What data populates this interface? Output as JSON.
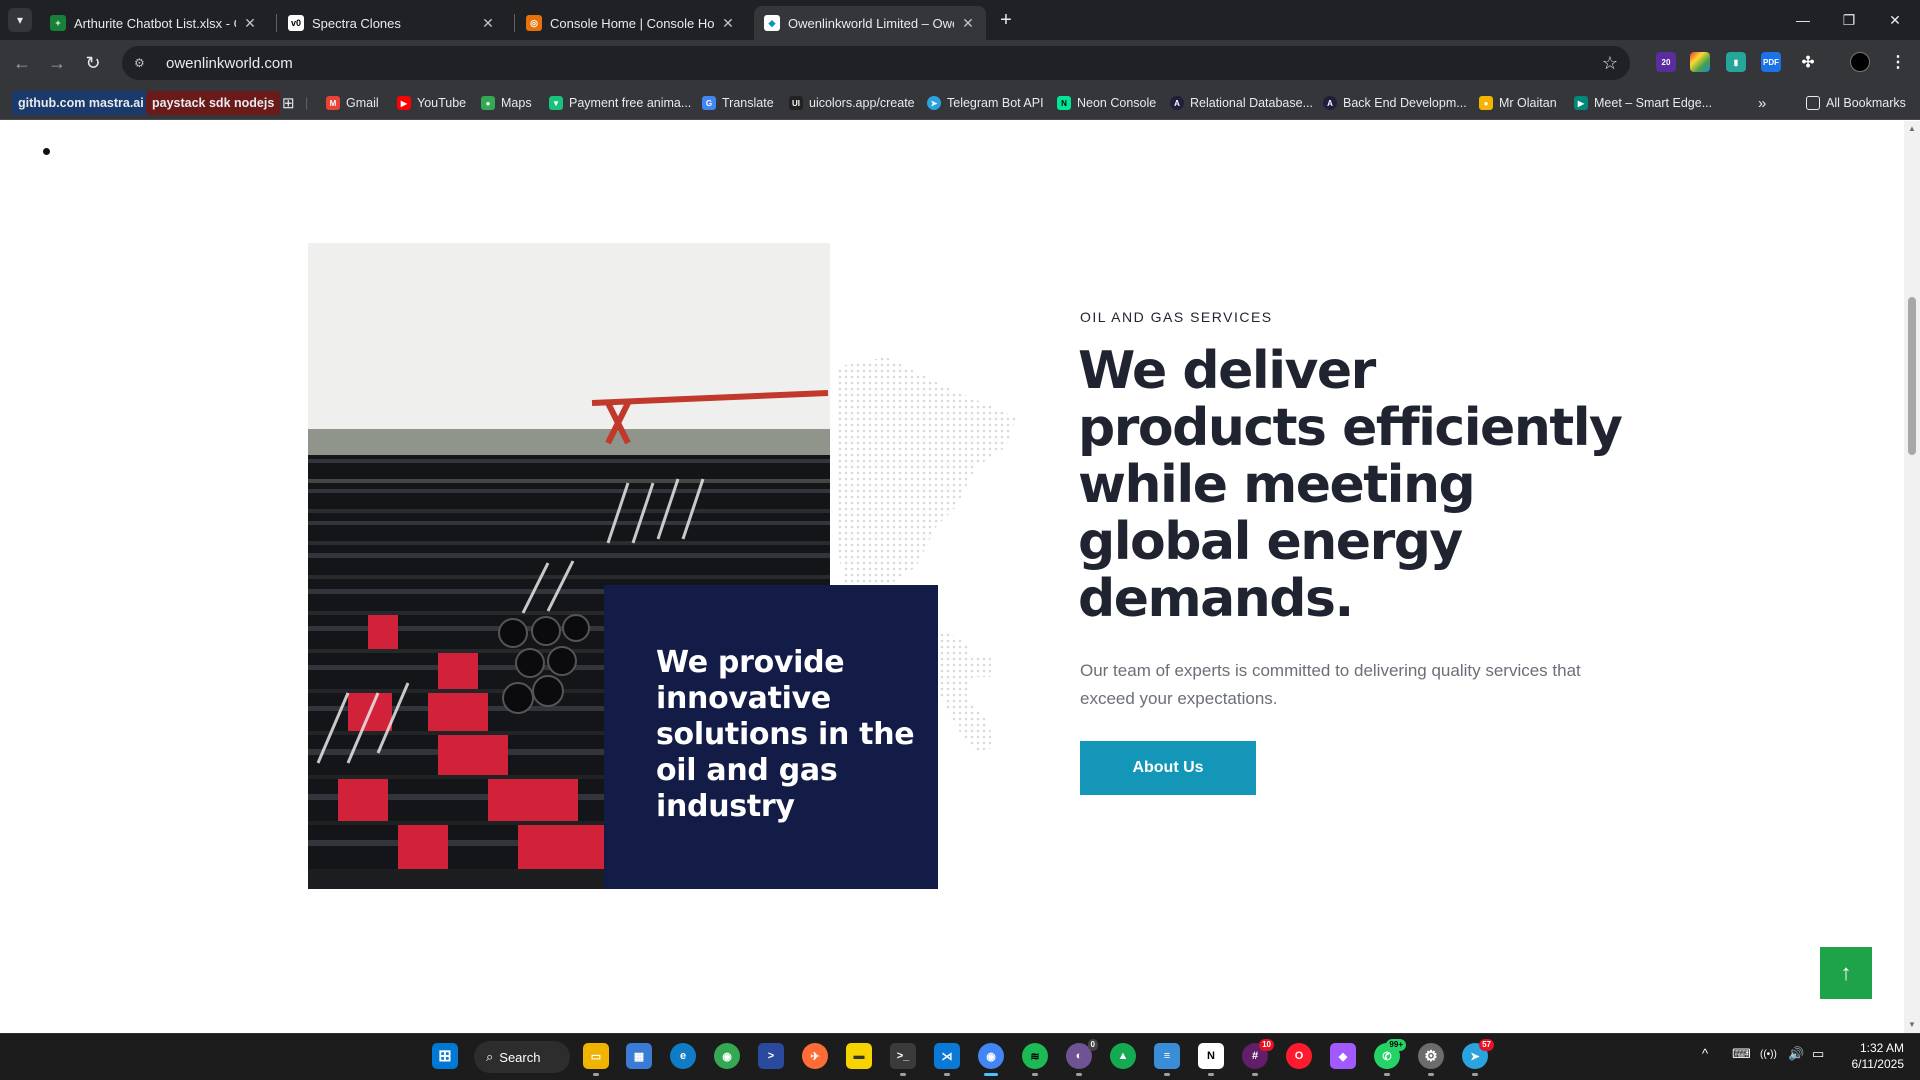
{
  "browser": {
    "tab_menu_icon": "chevron-down-icon",
    "tabs": [
      {
        "title": "Arthurite Chatbot List.xlsx - Go",
        "favicon_color": "#188038",
        "favicon_glyph": "+",
        "close": "✕"
      },
      {
        "title": "Spectra Clones",
        "favicon_color": "#ffffff",
        "favicon_glyph": "v0",
        "close": "✕"
      },
      {
        "title": "Console Home | Console Home",
        "favicon_color": "#e8710a",
        "favicon_glyph": "◎",
        "close": "✕"
      },
      {
        "title": "Owenlinkworld Limited – Owen",
        "favicon_color": "#ffffff",
        "favicon_glyph": "◆",
        "close": "✕"
      }
    ],
    "new_tab": "+",
    "window_controls": {
      "minimize": "—",
      "restore": "❐",
      "close": "✕"
    },
    "nav": {
      "back": "←",
      "forward": "→",
      "reload": "↻"
    },
    "url": "owenlinkworld.com",
    "bookmark_star": "☆",
    "extension_badge": "20",
    "bookmarks": [
      {
        "label": "github.com mastra.ai",
        "chip_color": "#1a3a6b"
      },
      {
        "label": "paystack sdk nodejs",
        "chip_color": "#6b1a1a"
      },
      {
        "label": "Gmail",
        "icon_color": "#ea4335",
        "glyph": "M"
      },
      {
        "label": "YouTube",
        "icon_color": "#ff0000",
        "glyph": "▶"
      },
      {
        "label": "Maps",
        "icon_color": "#34a853",
        "glyph": "●"
      },
      {
        "label": "Payment free anima...",
        "icon_color": "#19c37d",
        "glyph": "▼"
      },
      {
        "label": "Translate",
        "icon_color": "#4285f4",
        "glyph": "G"
      },
      {
        "label": "uicolors.app/create",
        "icon_color": "#222222",
        "glyph": "UI"
      },
      {
        "label": "Telegram Bot API",
        "icon_color": "#2aa3df",
        "glyph": "➤"
      },
      {
        "label": "Neon Console",
        "icon_color": "#00e699",
        "glyph": "N"
      },
      {
        "label": "Relational Database...",
        "icon_color": "#1f1f3d",
        "glyph": "A"
      },
      {
        "label": "Back End Developm...",
        "icon_color": "#1f1f3d",
        "glyph": "A"
      },
      {
        "label": "Mr Olaitan",
        "icon_color": "#f4b400",
        "glyph": "●"
      },
      {
        "label": "Meet – Smart Edge...",
        "icon_color": "#00897b",
        "glyph": "▶"
      }
    ],
    "bookmarks_overflow": "»",
    "all_bookmarks": "All Bookmarks"
  },
  "page": {
    "eyebrow": "OIL AND GAS SERVICES",
    "headline": "We deliver products efficiently while meeting global energy demands.",
    "lead": "Our team of experts is committed to delivering quality services that exceed your expectations.",
    "cta": "About Us",
    "overlay_title": "We provide innovative solutions in the oil and gas industry",
    "back_to_top": "↑",
    "colors": {
      "navy": "#131b47",
      "cta": "#1496b8",
      "back_to_top": "#1fa349",
      "headline": "#1f2430"
    }
  },
  "taskbar": {
    "search_label": "Search",
    "apps": [
      {
        "name": "windows-start",
        "color": "#0078d4",
        "glyph": "⊞"
      },
      {
        "name": "file-explorer",
        "color": "#f0b400",
        "glyph": "▭"
      },
      {
        "name": "ms-store",
        "color": "#3a7bd5",
        "glyph": "▦"
      },
      {
        "name": "edge",
        "color": "#0f7cc5",
        "glyph": "e"
      },
      {
        "name": "chrome",
        "color": "#34a853",
        "glyph": "◉"
      },
      {
        "name": "powershell",
        "color": "#2b4a9e",
        "glyph": ">"
      },
      {
        "name": "postman",
        "color": "#ff6c37",
        "glyph": "✈"
      },
      {
        "name": "sticky-notes",
        "color": "#f7d300",
        "glyph": "▬"
      },
      {
        "name": "terminal",
        "color": "#3b3b3b",
        "glyph": ">_"
      },
      {
        "name": "vscode",
        "color": "#0a7ad6",
        "glyph": "⋊"
      },
      {
        "name": "chrome-active",
        "color": "#4285f4",
        "glyph": "◉"
      },
      {
        "name": "spotify",
        "color": "#1db954",
        "glyph": "≋"
      },
      {
        "name": "github-desktop",
        "color": "#6e5494",
        "glyph": "◐",
        "badge": "0"
      },
      {
        "name": "mongodb",
        "color": "#13aa52",
        "glyph": "▲"
      },
      {
        "name": "notepad",
        "color": "#3a8ed8",
        "glyph": "≡"
      },
      {
        "name": "notion",
        "color": "#ffffff",
        "glyph": "N"
      },
      {
        "name": "slack",
        "color": "#611f69",
        "glyph": "#",
        "badge": "10"
      },
      {
        "name": "opera",
        "color": "#ff1b2d",
        "glyph": "O"
      },
      {
        "name": "figma",
        "color": "#a259ff",
        "glyph": "◆"
      },
      {
        "name": "whatsapp",
        "color": "#25d366",
        "glyph": "✆",
        "badge": "99+"
      },
      {
        "name": "settings",
        "color": "#6c6c6c",
        "glyph": "⚙"
      },
      {
        "name": "telegram",
        "color": "#2aa3df",
        "glyph": "➤",
        "badge": "57"
      }
    ],
    "tray": {
      "chevron": "^",
      "keyboard": "⌨",
      "wifi": "((•))",
      "volume": "🔊",
      "battery": "▭"
    },
    "time": "1:32 AM",
    "date": "6/11/2025"
  }
}
